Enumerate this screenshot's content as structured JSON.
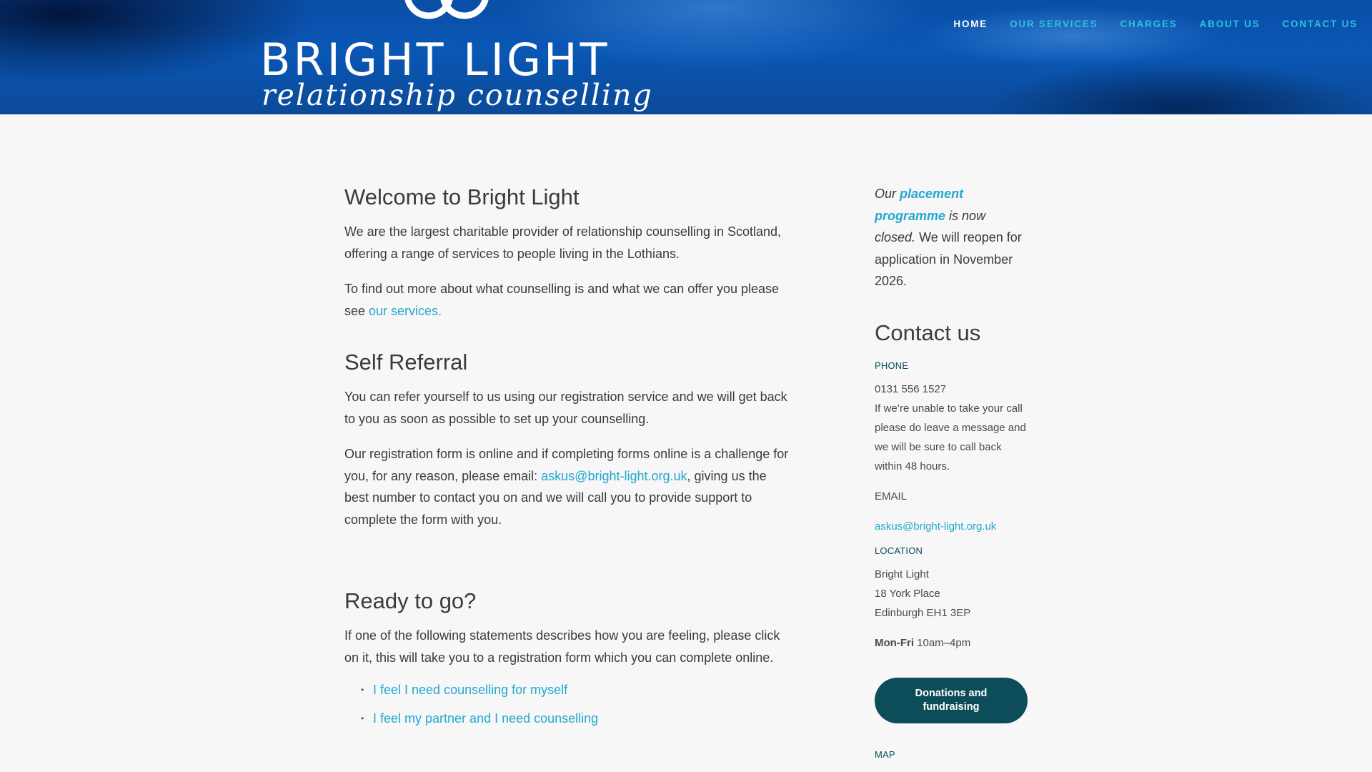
{
  "brand": {
    "title": "BRIGHT LIGHT",
    "subtitle": "relationship counselling"
  },
  "nav": {
    "items": [
      {
        "label": "HOME",
        "active": true
      },
      {
        "label": "OUR SERVICES",
        "active": false
      },
      {
        "label": "CHARGES",
        "active": false
      },
      {
        "label": "ABOUT US",
        "active": false
      },
      {
        "label": "CONTACT US",
        "active": false
      }
    ]
  },
  "main": {
    "welcome_heading": "Welcome to Bright Light",
    "welcome_p1": "We are the largest charitable provider of relationship counselling in Scotland, offering a range of services to people living in the Lothians.",
    "welcome_p2_prefix": "To find out more about what counselling is and what we can offer you please see ",
    "welcome_p2_link": "our services.",
    "self_referral_heading": "Self Referral",
    "self_referral_p1": "You can refer yourself to us using our registration service and we will get back to you as soon as possible to set up your counselling.",
    "self_referral_p2_prefix": "Our registration form is online and if completing forms online is a challenge for you, for any reason, please email: ",
    "self_referral_p2_email": "askus@bright-light.org.uk",
    "self_referral_p2_suffix": ", giving us the best number to contact you on and we will call you to provide support to complete the form with you.",
    "ready_heading": "Ready to go?",
    "ready_p": "If one of the following statements describes how you are feeling, please click on it, this will take you to a registration form which you can complete online.",
    "options": [
      "I feel I need counselling for myself",
      "I feel my partner and I need counselling"
    ]
  },
  "sidebar": {
    "notice": {
      "our": "Our",
      "placement": "placement programme",
      "is_now": "is now",
      "closed": "closed.",
      "rest": "We will reopen for application in November 2026."
    },
    "contact_heading": "Contact us",
    "phone_label": "PHONE",
    "phone_number": "0131 556 1527",
    "phone_note": "If we’re unable to take your call please do leave a message and we will be sure to call back within 48 hours.",
    "email_label": "EMAIL",
    "email": "askus@bright-light.org.uk",
    "location_label": "LOCATION",
    "address": [
      "Bright Light",
      "18 York Place",
      "Edinburgh EH1 3EP"
    ],
    "hours_days": "Mon-Fri",
    "hours_time": "10am–4pm",
    "donate_button": "Donations and fundraising",
    "map_label": "MAP"
  },
  "colors": {
    "accent": "#21a8cf",
    "nav_link": "#2ec2dc",
    "header_blue": "#0a57b5",
    "button_bg": "#0d4d5a"
  }
}
